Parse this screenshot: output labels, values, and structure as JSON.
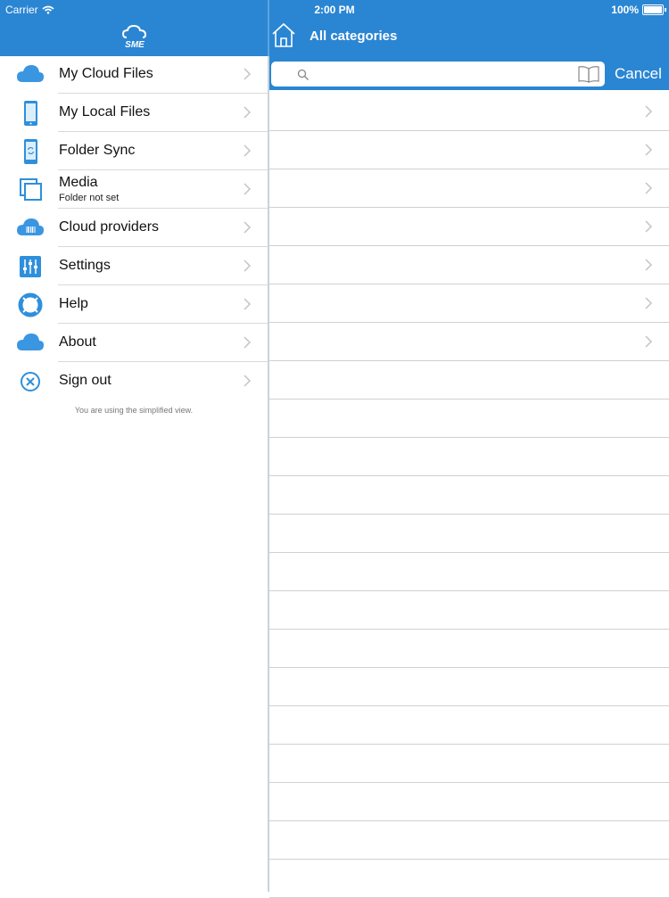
{
  "status_bar": {
    "carrier": "Carrier",
    "time": "2:00 PM",
    "battery": "100%"
  },
  "sidebar": {
    "logo_text": "SME",
    "items": [
      {
        "label": "My Cloud Files",
        "icon": "cloud-icon"
      },
      {
        "label": "My Local Files",
        "icon": "phone-icon"
      },
      {
        "label": "Folder Sync",
        "icon": "sync-phone-icon"
      },
      {
        "label": "Media",
        "sublabel": "Folder not set",
        "icon": "media-icon"
      },
      {
        "label": "Cloud providers",
        "icon": "cloud-providers-icon"
      },
      {
        "label": "Settings",
        "icon": "sliders-icon"
      },
      {
        "label": "Help",
        "icon": "lifebuoy-icon"
      },
      {
        "label": "About",
        "icon": "cloud-icon"
      },
      {
        "label": "Sign out",
        "icon": "close-circle-icon"
      }
    ],
    "footnote": "You are using the simplified view."
  },
  "main": {
    "title": "All categories",
    "search": {
      "placeholder": "",
      "cancel_label": "Cancel"
    },
    "rows_with_chevron": 7,
    "total_rows": 21
  },
  "colors": {
    "accent": "#2a86d3",
    "icon_blue": "#2f8fdb"
  }
}
